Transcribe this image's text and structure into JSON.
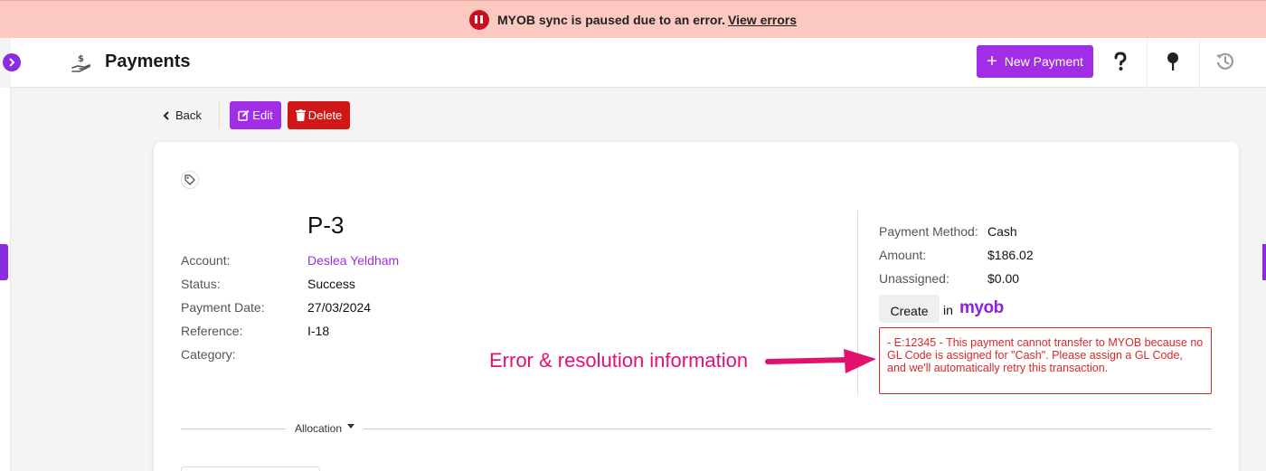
{
  "banner": {
    "message": "MYOB sync is paused due to an error.",
    "link": "View errors"
  },
  "header": {
    "title": "Payments",
    "new_button": "New Payment"
  },
  "toolbar": {
    "back": "Back",
    "edit": "Edit",
    "delete": "Delete"
  },
  "payment": {
    "id": "P-3",
    "fields": [
      {
        "label": "Account:",
        "value": "Deslea Yeldham"
      },
      {
        "label": "Status:",
        "value": "Success"
      },
      {
        "label": "Payment Date:",
        "value": "27/03/2024"
      },
      {
        "label": "Reference:",
        "value": "I-18"
      },
      {
        "label": "Category:",
        "value": ""
      }
    ],
    "summary": [
      {
        "label": "Payment Method:",
        "value": "Cash"
      },
      {
        "label": "Amount:",
        "value": "$186.02"
      },
      {
        "label": "Unassigned:",
        "value": "$0.00"
      }
    ]
  },
  "sync": {
    "create_button": "Create",
    "in_text": "in",
    "brand": "myob",
    "error": "- E:12345 - This payment cannot transfer to MYOB because no GL Code is assigned for \"Cash\". Please assign a GL Code, and we'll automatically retry this transaction."
  },
  "annotation": "Error & resolution information",
  "allocation": "Allocation",
  "colors": {
    "accent": "#a12de6",
    "danger": "#d01717",
    "banner_bg": "#fcc9c0",
    "annotation": "#e0126d"
  }
}
